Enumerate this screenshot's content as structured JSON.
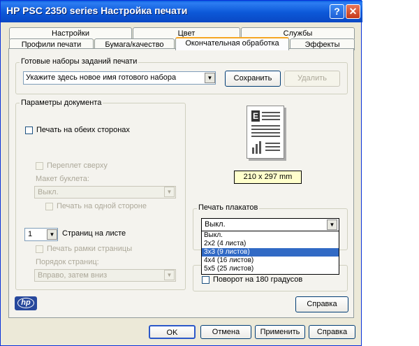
{
  "window": {
    "title": "HP PSC 2350 series Настройка печати",
    "help_glyph": "?",
    "close_glyph": "✕"
  },
  "tabs": {
    "row1": [
      "Настройки",
      "Цвет",
      "Службы"
    ],
    "row2": [
      "Профили печати",
      "Бумага/качество",
      "Окончательная обработка",
      "Эффекты"
    ],
    "active": "Окончательная обработка"
  },
  "presets": {
    "group_label": "Готовые наборы заданий печати",
    "combo_value": "Укажите здесь новое имя готового набора",
    "save_button": "Сохранить",
    "delete_button": "Удалить"
  },
  "document": {
    "group_label": "Параметры документа",
    "duplex_label": "Печать на обеих сторонах",
    "flip_top_label": "Переплет сверху",
    "booklet_label": "Макет буклета:",
    "booklet_value": "Выкл.",
    "one_side_label": "Печать на одной стороне",
    "pages_per_sheet_value": "1",
    "pages_per_sheet_label": "Страниц на листе",
    "page_borders_label": "Печать рамки страницы",
    "page_order_label": "Порядок страниц:",
    "page_order_value": "Вправо, затем вниз"
  },
  "preview": {
    "paper_size": "210 x 297 mm",
    "paper_letter": "E"
  },
  "poster": {
    "group_label": "Печать плакатов",
    "value": "Выкл.",
    "options": [
      "Выкл.",
      "2x2 (4 листа)",
      "3x3 (9 листов)",
      "4x4 (16 листов)",
      "5x5 (25 листов)"
    ],
    "highlighted": "3x3 (9 листов)"
  },
  "rotate": {
    "label": "Поворот на 180 градусов"
  },
  "logo": {
    "text": "hp"
  },
  "panel_help_button": "Справка",
  "footer": {
    "ok": "OK",
    "cancel": "Отмена",
    "apply": "Применить",
    "help": "Справка"
  },
  "colors": {
    "title_bar": "#0a5fe0",
    "selection": "#316ac5",
    "active_tab_accent": "#f5a623",
    "paper_size_bg": "#ffffcc"
  }
}
